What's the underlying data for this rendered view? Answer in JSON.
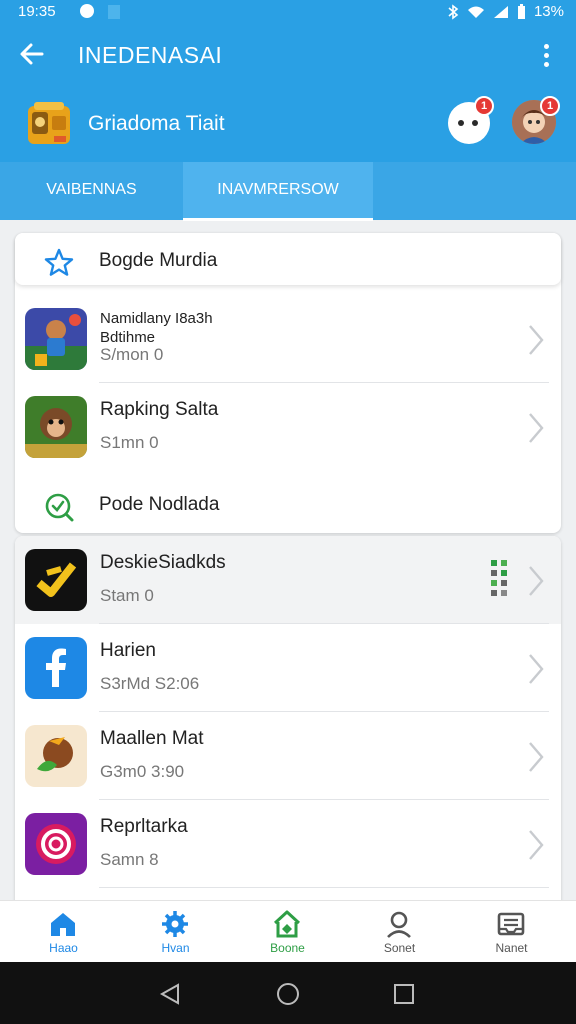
{
  "status_bar": {
    "time": "19:35",
    "battery": "13%"
  },
  "app_bar": {
    "title": "INEDENASAI"
  },
  "brand": {
    "name": "Griadoma Tiait"
  },
  "badges": {
    "chat": "1",
    "profile": "1"
  },
  "tabs": [
    {
      "label": "VAIBENNAS",
      "active": false
    },
    {
      "label": "INAVMRERSOW",
      "active": true
    }
  ],
  "sections": {
    "first": {
      "label": "Bogde Murdia",
      "icon": "star-icon"
    },
    "second": {
      "label": "Pode Nodlada",
      "icon": "search-check-icon"
    }
  },
  "apps": [
    {
      "name": "Namidlany I8a3h Bdtihme",
      "sub": "S/mon 0",
      "icon": "game-character-icon"
    },
    {
      "name": "Rapking Salta",
      "sub": "S1mn 0",
      "icon": "game-monkey-icon"
    },
    {
      "name": "DeskieSiadkds",
      "sub": "Stam 0",
      "icon": "yellow-check-app-icon"
    },
    {
      "name": "Harien",
      "sub": "S3rMd S2:06",
      "icon": "facebook-icon"
    },
    {
      "name": "Maallen Mat",
      "sub": "G3m0 3:90",
      "icon": "coconut-app-icon"
    },
    {
      "name": "Reprltarka",
      "sub": "Samn 8",
      "icon": "spiral-app-icon"
    }
  ],
  "bottom_nav": [
    {
      "label": "Haao",
      "icon": "home-icon",
      "color": "#1e88e5"
    },
    {
      "label": "Hvan",
      "icon": "gear-icon",
      "color": "#1e88e5"
    },
    {
      "label": "Boone",
      "icon": "store-icon",
      "color": "#2e9e45"
    },
    {
      "label": "Sonet",
      "icon": "person-icon",
      "color": "#555555"
    },
    {
      "label": "Nanet",
      "icon": "inbox-icon",
      "color": "#555555"
    }
  ],
  "colors": {
    "primary": "#2aa0e4",
    "badge": "#e53935"
  }
}
